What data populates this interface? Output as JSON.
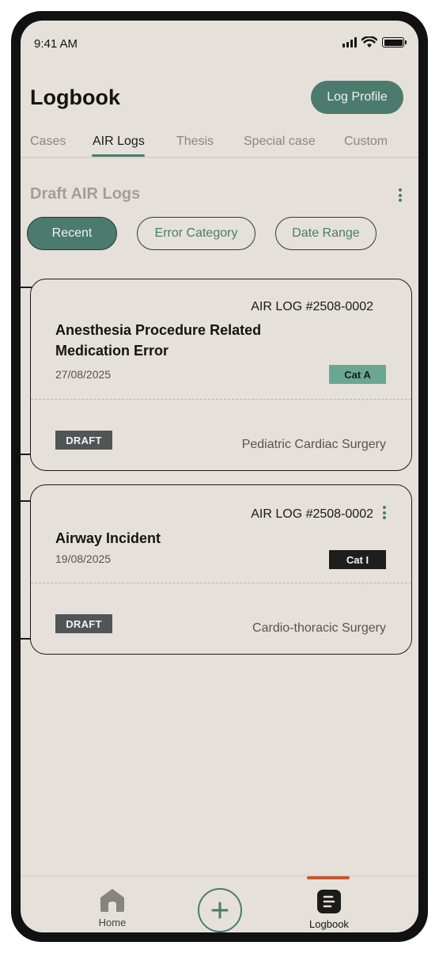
{
  "status_bar": {
    "time": "9:41 AM"
  },
  "header": {
    "title": "Logbook",
    "log_profile_label": "Log Profile"
  },
  "tabs": [
    {
      "label": "Cases",
      "active": false
    },
    {
      "label": "AIR Logs",
      "active": true
    },
    {
      "label": "Thesis",
      "active": false
    },
    {
      "label": "Special case",
      "active": false
    },
    {
      "label": "Custom",
      "active": false
    }
  ],
  "section": {
    "title": "Draft AIR Logs"
  },
  "filters": [
    {
      "label": "Recent",
      "active": true
    },
    {
      "label": "Error Category",
      "active": false
    },
    {
      "label": "Date Range",
      "active": false
    }
  ],
  "logs": [
    {
      "id": "AIR LOG #2508-0002",
      "title_line1": "Anesthesia Procedure Related",
      "title_line2": "Medication Error",
      "date": "27/08/2025",
      "category": "Cat A",
      "category_color": "#6aa793",
      "status": "DRAFT",
      "department": "Pediatric Cardiac Surgery"
    },
    {
      "id": "AIR LOG #2508-0002",
      "title_line1": "Airway Incident",
      "date": "19/08/2025",
      "category": "Cat I",
      "category_color": "#1e1e1e",
      "status": "DRAFT",
      "department": "Cardio-thoracic Surgery"
    }
  ],
  "bottom_nav": {
    "home_label": "Home",
    "logbook_label": "Logbook"
  },
  "colors": {
    "accent": "#4a7b6e",
    "background": "#e5e1da",
    "active_indicator": "#c8562e"
  }
}
